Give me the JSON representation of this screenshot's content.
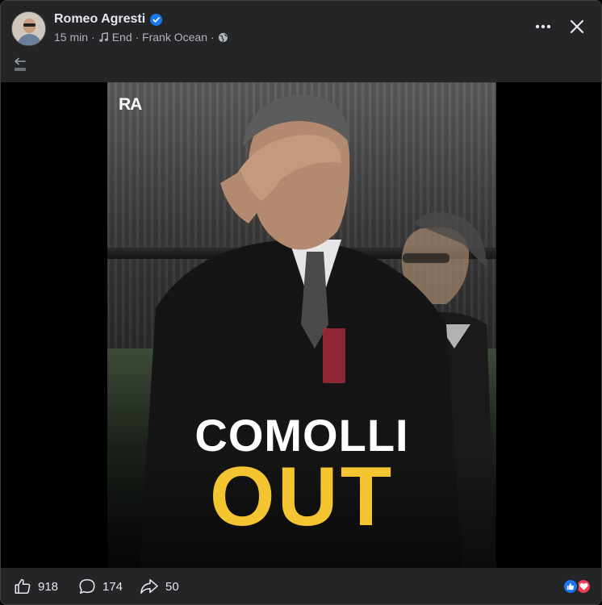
{
  "post": {
    "author": "Romeo Agresti",
    "time": "15 min",
    "music_track": "End · Frank Ocean",
    "verified": true,
    "audience": "public"
  },
  "media": {
    "brand_logo": "RA",
    "headline_line1": "COMOLLI",
    "headline_line2": "OUT",
    "headline_color": "#f5c531"
  },
  "footer": {
    "likes": "918",
    "comments": "174",
    "shares": "50"
  },
  "icons": {
    "more": "more-horizontal-icon",
    "close": "close-icon",
    "back": "back-end-icon",
    "mute": "volume-muted-icon",
    "music": "music-note-icon",
    "globe": "globe-icon",
    "like": "thumb-up-icon",
    "comment": "comment-icon",
    "share": "share-icon"
  },
  "colors": {
    "background": "#242526",
    "text": "#e4e6eb",
    "muted_text": "#b0b3b8",
    "verified_blue": "#1877f2",
    "love_red": "#f33e58"
  }
}
